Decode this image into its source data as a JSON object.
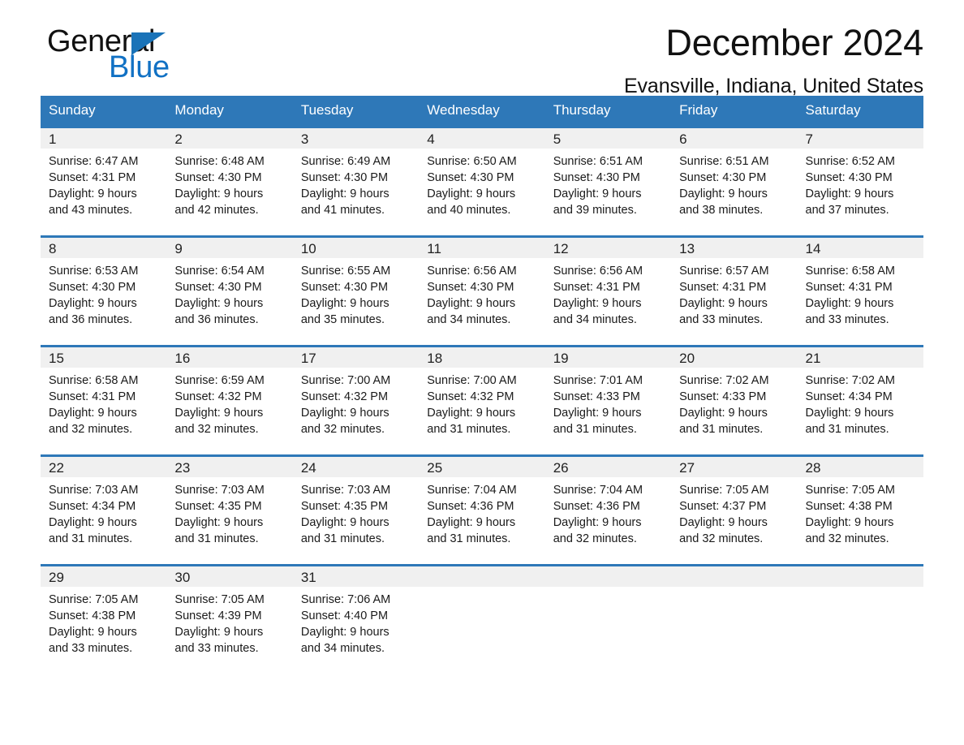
{
  "logo": {
    "word1": "General",
    "word2": "Blue",
    "triangle_color": "#1a73b8",
    "blue_color": "#1171c4"
  },
  "header": {
    "title": "December 2024",
    "subtitle": "Evansville, Indiana, United States",
    "header_bg": "#2e78b8",
    "header_text_color": "#ffffff"
  },
  "calendar": {
    "weekday_headers": [
      "Sunday",
      "Monday",
      "Tuesday",
      "Wednesday",
      "Thursday",
      "Friday",
      "Saturday"
    ],
    "weeks": [
      [
        {
          "day": "1",
          "sunrise": "Sunrise: 6:47 AM",
          "sunset": "Sunset: 4:31 PM",
          "daylight1": "Daylight: 9 hours",
          "daylight2": "and 43 minutes."
        },
        {
          "day": "2",
          "sunrise": "Sunrise: 6:48 AM",
          "sunset": "Sunset: 4:30 PM",
          "daylight1": "Daylight: 9 hours",
          "daylight2": "and 42 minutes."
        },
        {
          "day": "3",
          "sunrise": "Sunrise: 6:49 AM",
          "sunset": "Sunset: 4:30 PM",
          "daylight1": "Daylight: 9 hours",
          "daylight2": "and 41 minutes."
        },
        {
          "day": "4",
          "sunrise": "Sunrise: 6:50 AM",
          "sunset": "Sunset: 4:30 PM",
          "daylight1": "Daylight: 9 hours",
          "daylight2": "and 40 minutes."
        },
        {
          "day": "5",
          "sunrise": "Sunrise: 6:51 AM",
          "sunset": "Sunset: 4:30 PM",
          "daylight1": "Daylight: 9 hours",
          "daylight2": "and 39 minutes."
        },
        {
          "day": "6",
          "sunrise": "Sunrise: 6:51 AM",
          "sunset": "Sunset: 4:30 PM",
          "daylight1": "Daylight: 9 hours",
          "daylight2": "and 38 minutes."
        },
        {
          "day": "7",
          "sunrise": "Sunrise: 6:52 AM",
          "sunset": "Sunset: 4:30 PM",
          "daylight1": "Daylight: 9 hours",
          "daylight2": "and 37 minutes."
        }
      ],
      [
        {
          "day": "8",
          "sunrise": "Sunrise: 6:53 AM",
          "sunset": "Sunset: 4:30 PM",
          "daylight1": "Daylight: 9 hours",
          "daylight2": "and 36 minutes."
        },
        {
          "day": "9",
          "sunrise": "Sunrise: 6:54 AM",
          "sunset": "Sunset: 4:30 PM",
          "daylight1": "Daylight: 9 hours",
          "daylight2": "and 36 minutes."
        },
        {
          "day": "10",
          "sunrise": "Sunrise: 6:55 AM",
          "sunset": "Sunset: 4:30 PM",
          "daylight1": "Daylight: 9 hours",
          "daylight2": "and 35 minutes."
        },
        {
          "day": "11",
          "sunrise": "Sunrise: 6:56 AM",
          "sunset": "Sunset: 4:30 PM",
          "daylight1": "Daylight: 9 hours",
          "daylight2": "and 34 minutes."
        },
        {
          "day": "12",
          "sunrise": "Sunrise: 6:56 AM",
          "sunset": "Sunset: 4:31 PM",
          "daylight1": "Daylight: 9 hours",
          "daylight2": "and 34 minutes."
        },
        {
          "day": "13",
          "sunrise": "Sunrise: 6:57 AM",
          "sunset": "Sunset: 4:31 PM",
          "daylight1": "Daylight: 9 hours",
          "daylight2": "and 33 minutes."
        },
        {
          "day": "14",
          "sunrise": "Sunrise: 6:58 AM",
          "sunset": "Sunset: 4:31 PM",
          "daylight1": "Daylight: 9 hours",
          "daylight2": "and 33 minutes."
        }
      ],
      [
        {
          "day": "15",
          "sunrise": "Sunrise: 6:58 AM",
          "sunset": "Sunset: 4:31 PM",
          "daylight1": "Daylight: 9 hours",
          "daylight2": "and 32 minutes."
        },
        {
          "day": "16",
          "sunrise": "Sunrise: 6:59 AM",
          "sunset": "Sunset: 4:32 PM",
          "daylight1": "Daylight: 9 hours",
          "daylight2": "and 32 minutes."
        },
        {
          "day": "17",
          "sunrise": "Sunrise: 7:00 AM",
          "sunset": "Sunset: 4:32 PM",
          "daylight1": "Daylight: 9 hours",
          "daylight2": "and 32 minutes."
        },
        {
          "day": "18",
          "sunrise": "Sunrise: 7:00 AM",
          "sunset": "Sunset: 4:32 PM",
          "daylight1": "Daylight: 9 hours",
          "daylight2": "and 31 minutes."
        },
        {
          "day": "19",
          "sunrise": "Sunrise: 7:01 AM",
          "sunset": "Sunset: 4:33 PM",
          "daylight1": "Daylight: 9 hours",
          "daylight2": "and 31 minutes."
        },
        {
          "day": "20",
          "sunrise": "Sunrise: 7:02 AM",
          "sunset": "Sunset: 4:33 PM",
          "daylight1": "Daylight: 9 hours",
          "daylight2": "and 31 minutes."
        },
        {
          "day": "21",
          "sunrise": "Sunrise: 7:02 AM",
          "sunset": "Sunset: 4:34 PM",
          "daylight1": "Daylight: 9 hours",
          "daylight2": "and 31 minutes."
        }
      ],
      [
        {
          "day": "22",
          "sunrise": "Sunrise: 7:03 AM",
          "sunset": "Sunset: 4:34 PM",
          "daylight1": "Daylight: 9 hours",
          "daylight2": "and 31 minutes."
        },
        {
          "day": "23",
          "sunrise": "Sunrise: 7:03 AM",
          "sunset": "Sunset: 4:35 PM",
          "daylight1": "Daylight: 9 hours",
          "daylight2": "and 31 minutes."
        },
        {
          "day": "24",
          "sunrise": "Sunrise: 7:03 AM",
          "sunset": "Sunset: 4:35 PM",
          "daylight1": "Daylight: 9 hours",
          "daylight2": "and 31 minutes."
        },
        {
          "day": "25",
          "sunrise": "Sunrise: 7:04 AM",
          "sunset": "Sunset: 4:36 PM",
          "daylight1": "Daylight: 9 hours",
          "daylight2": "and 31 minutes."
        },
        {
          "day": "26",
          "sunrise": "Sunrise: 7:04 AM",
          "sunset": "Sunset: 4:36 PM",
          "daylight1": "Daylight: 9 hours",
          "daylight2": "and 32 minutes."
        },
        {
          "day": "27",
          "sunrise": "Sunrise: 7:05 AM",
          "sunset": "Sunset: 4:37 PM",
          "daylight1": "Daylight: 9 hours",
          "daylight2": "and 32 minutes."
        },
        {
          "day": "28",
          "sunrise": "Sunrise: 7:05 AM",
          "sunset": "Sunset: 4:38 PM",
          "daylight1": "Daylight: 9 hours",
          "daylight2": "and 32 minutes."
        }
      ],
      [
        {
          "day": "29",
          "sunrise": "Sunrise: 7:05 AM",
          "sunset": "Sunset: 4:38 PM",
          "daylight1": "Daylight: 9 hours",
          "daylight2": "and 33 minutes."
        },
        {
          "day": "30",
          "sunrise": "Sunrise: 7:05 AM",
          "sunset": "Sunset: 4:39 PM",
          "daylight1": "Daylight: 9 hours",
          "daylight2": "and 33 minutes."
        },
        {
          "day": "31",
          "sunrise": "Sunrise: 7:06 AM",
          "sunset": "Sunset: 4:40 PM",
          "daylight1": "Daylight: 9 hours",
          "daylight2": "and 34 minutes."
        },
        {
          "day": "",
          "sunrise": "",
          "sunset": "",
          "daylight1": "",
          "daylight2": ""
        },
        {
          "day": "",
          "sunrise": "",
          "sunset": "",
          "daylight1": "",
          "daylight2": ""
        },
        {
          "day": "",
          "sunrise": "",
          "sunset": "",
          "daylight1": "",
          "daylight2": ""
        },
        {
          "day": "",
          "sunrise": "",
          "sunset": "",
          "daylight1": "",
          "daylight2": ""
        }
      ]
    ]
  }
}
